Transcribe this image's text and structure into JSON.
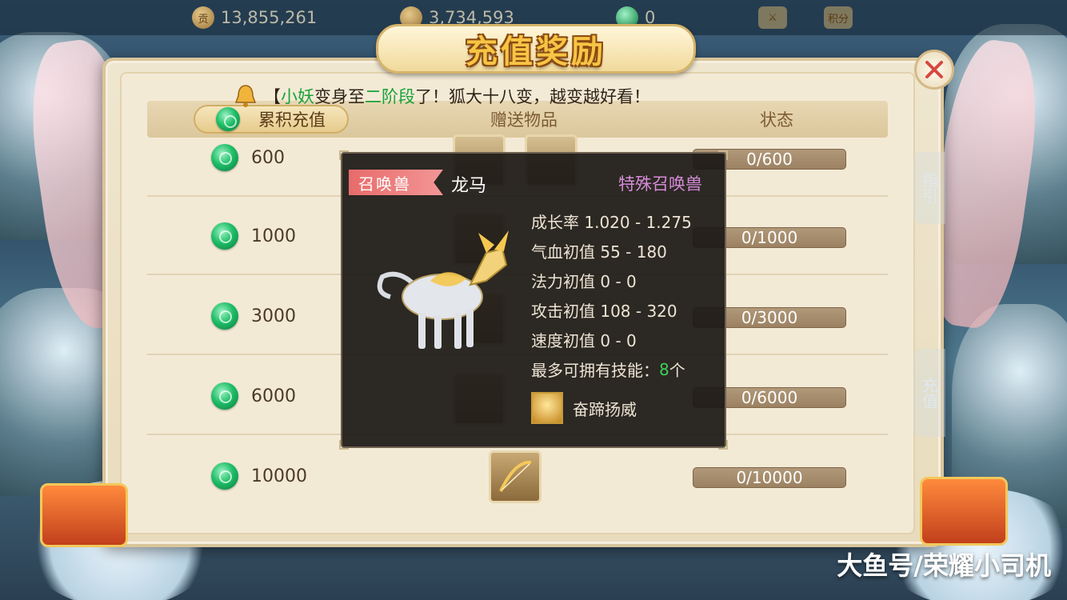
{
  "topbar": {
    "silver_label": "贡",
    "silver": "13,855,261",
    "gold": "3,734,593",
    "jade": "0",
    "points_label": "积分"
  },
  "title": "充值奖励",
  "notice": {
    "bracket": "【",
    "name": "小妖",
    "text1": "变身至",
    "stage": "二阶段",
    "text2": "了！狐大十八变，越变越好看！"
  },
  "table": {
    "headers": [
      "累积充值",
      "赠送物品",
      "状态"
    ],
    "rows": [
      {
        "amount": "600",
        "status": "0/600"
      },
      {
        "amount": "1000",
        "status": "0/1000"
      },
      {
        "amount": "3000",
        "status": "0/3000"
      },
      {
        "amount": "6000",
        "status": "0/6000"
      },
      {
        "amount": "10000",
        "status": "0/10000"
      }
    ]
  },
  "tooltip": {
    "tag": "召唤兽",
    "name": "龙马",
    "type": "特殊召唤兽",
    "stats": [
      "成长率 1.020 - 1.275",
      "气血初值 55 - 180",
      "法力初值 0 - 0",
      "攻击初值 108 - 320",
      "速度初值 0 - 0"
    ],
    "skill_count_label": "最多可拥有技能：",
    "skill_count": "8",
    "skill_count_unit": "个",
    "skill_name": "奋蹄扬威"
  },
  "side_tabs": [
    "指引",
    "充值"
  ],
  "watermark": "大鱼号/荣耀小司机",
  "colors": {
    "accent_green": "#19a23a",
    "title_gold": "#f7c544",
    "status_bar": "#9c8262",
    "tooltip_bg": "#1c1916",
    "type_purple": "#d58cd8"
  }
}
